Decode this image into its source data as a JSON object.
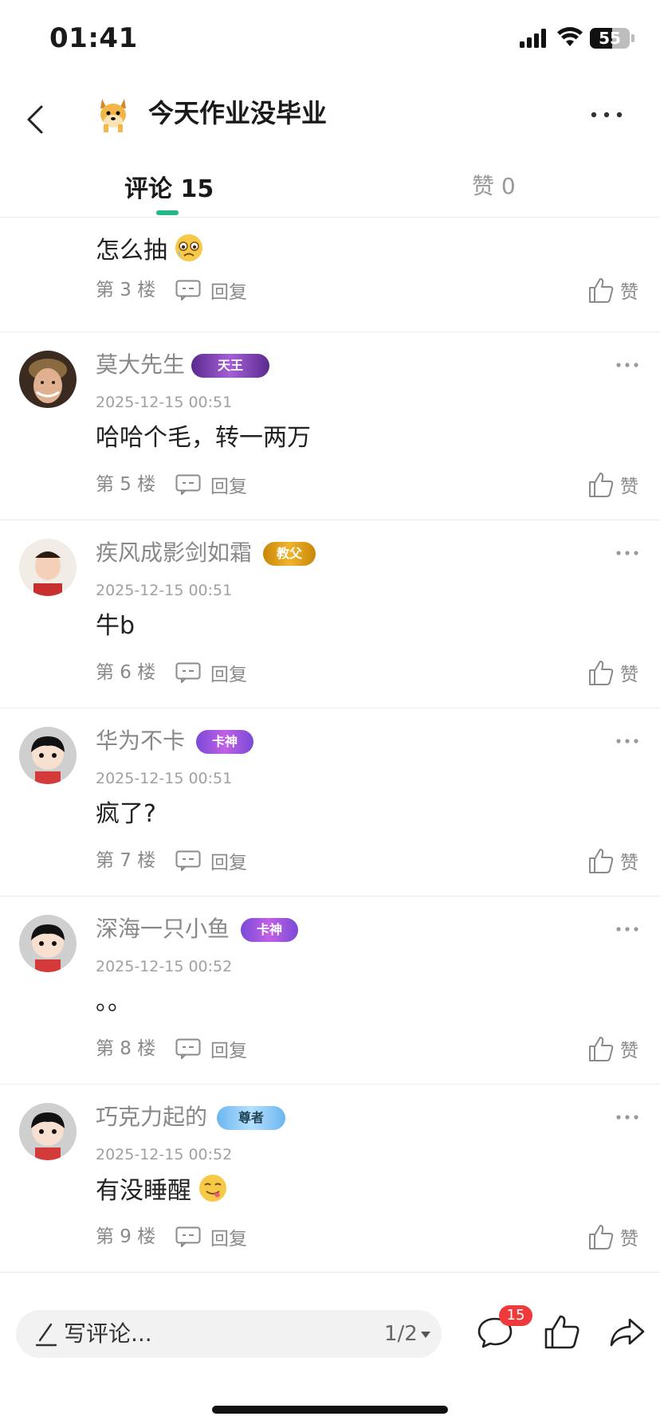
{
  "status_bar": {
    "time": "01:41",
    "battery": "55",
    "battery_level": 0.55
  },
  "nav": {
    "title": "今天作业没毕业"
  },
  "tabs": {
    "comments_label": "评论",
    "comments_count": "15",
    "likes_label": "赞",
    "likes_count": "0"
  },
  "common": {
    "reply_label": "回复",
    "like_label": "赞"
  },
  "comments": [
    {
      "text": "怎么抽",
      "floor": "第 3 楼",
      "emoji": "sad-emoji"
    },
    {
      "username": "莫大先生",
      "badge": "天王",
      "time": "2025-12-15 00:51",
      "text": "哈哈个毛，转一两万",
      "floor": "第 5 楼"
    },
    {
      "username": "疾风成影剑如霜",
      "badge": "教父",
      "time": "2025-12-15 00:51",
      "text": "牛b",
      "floor": "第 6 楼"
    },
    {
      "username": "华为不卡",
      "badge": "卡神",
      "time": "2025-12-15 00:51",
      "text": "疯了?",
      "floor": "第 7 楼"
    },
    {
      "username": "深海一只小鱼",
      "badge": "卡神",
      "time": "2025-12-15 00:52",
      "text": "。。",
      "floor": "第 8 楼"
    },
    {
      "username": "巧克力起的",
      "badge": "尊者",
      "time": "2025-12-15 00:52",
      "text": "有没睡醒",
      "floor": "第 9 楼",
      "emoji": "tongue-emoji"
    }
  ],
  "bottom_bar": {
    "placeholder": "写评论...",
    "page_indicator": "1/2",
    "comment_badge": "15"
  },
  "colors": {
    "accent": "#22b887",
    "badge_red": "#ee3a3a"
  }
}
